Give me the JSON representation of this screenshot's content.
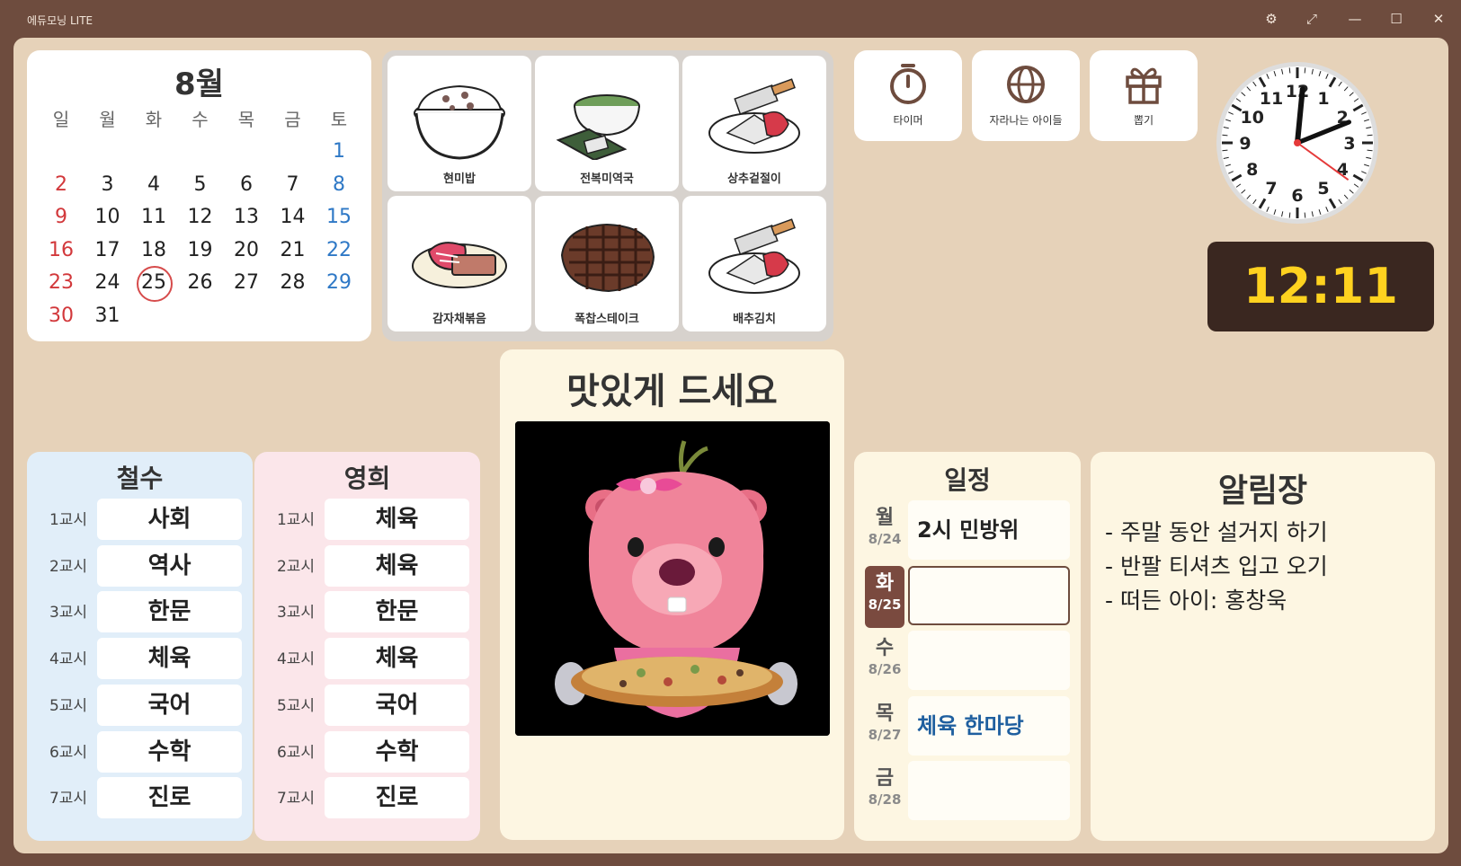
{
  "window": {
    "title": "에듀모닝 LITE",
    "controls": {
      "settings": "⚙",
      "expand": "⤢",
      "minimize": "—",
      "maximize": "☐",
      "close": "✕"
    }
  },
  "calendar": {
    "month": "8월",
    "weekdays": [
      "일",
      "월",
      "화",
      "수",
      "목",
      "금",
      "토"
    ],
    "weeks": [
      [
        "",
        "",
        "",
        "",
        "",
        "",
        "1"
      ],
      [
        "2",
        "3",
        "4",
        "5",
        "6",
        "7",
        "8"
      ],
      [
        "9",
        "10",
        "11",
        "12",
        "13",
        "14",
        "15"
      ],
      [
        "16",
        "17",
        "18",
        "19",
        "20",
        "21",
        "22"
      ],
      [
        "23",
        "24",
        "25",
        "26",
        "27",
        "28",
        "29"
      ],
      [
        "30",
        "31",
        "",
        "",
        "",
        "",
        ""
      ]
    ],
    "today": "25"
  },
  "meals": [
    {
      "name": "현미밥",
      "icon": "rice-bowl-icon"
    },
    {
      "name": "전복미역국",
      "icon": "seaweed-soup-icon"
    },
    {
      "name": "상추겉절이",
      "icon": "lettuce-salad-icon"
    },
    {
      "name": "감자채볶음",
      "icon": "potato-stirfry-icon"
    },
    {
      "name": "폭찹스테이크",
      "icon": "pork-steak-icon"
    },
    {
      "name": "배추김치",
      "icon": "kimchi-icon"
    }
  ],
  "tools": [
    {
      "label": "타이머",
      "icon": "stopwatch-icon"
    },
    {
      "label": "자라나는 아이들",
      "icon": "globe-icon"
    },
    {
      "label": "뽑기",
      "icon": "gift-icon"
    }
  ],
  "clock": {
    "numbers": [
      "12",
      "1",
      "2",
      "3",
      "4",
      "5",
      "6",
      "7",
      "8",
      "9",
      "10",
      "11"
    ],
    "hour": 12,
    "minute": 11,
    "second": 21
  },
  "digital_time": "12:11",
  "message": {
    "title": "맛있게 드세요",
    "image": "pink-beaver-with-pizza"
  },
  "timetables": [
    {
      "name": "철수",
      "bg": "#e1eef9",
      "rows": [
        {
          "period": "1교시",
          "subject": "사회"
        },
        {
          "period": "2교시",
          "subject": "역사"
        },
        {
          "period": "3교시",
          "subject": "한문"
        },
        {
          "period": "4교시",
          "subject": "체육"
        },
        {
          "period": "5교시",
          "subject": "국어"
        },
        {
          "period": "6교시",
          "subject": "수학"
        },
        {
          "period": "7교시",
          "subject": "진로"
        }
      ]
    },
    {
      "name": "영희",
      "bg": "#fbe6ea",
      "rows": [
        {
          "period": "1교시",
          "subject": "체육"
        },
        {
          "period": "2교시",
          "subject": "체육"
        },
        {
          "period": "3교시",
          "subject": "한문"
        },
        {
          "period": "4교시",
          "subject": "체육"
        },
        {
          "period": "5교시",
          "subject": "국어"
        },
        {
          "period": "6교시",
          "subject": "수학"
        },
        {
          "period": "7교시",
          "subject": "진로"
        }
      ]
    }
  ],
  "schedule": {
    "title": "일정",
    "days": [
      {
        "day": "월",
        "date": "8/24",
        "text": "2시 민방위"
      },
      {
        "day": "화",
        "date": "8/25",
        "text": ""
      },
      {
        "day": "수",
        "date": "8/26",
        "text": ""
      },
      {
        "day": "목",
        "date": "8/27",
        "text": "체육 한마당"
      },
      {
        "day": "금",
        "date": "8/28",
        "text": ""
      }
    ]
  },
  "notice": {
    "title": "알림장",
    "lines": [
      "- 주말 동안 설거지 하기",
      "- 반팔 티셔츠 입고 오기",
      "- 떠든 아이: 홍창욱"
    ]
  }
}
